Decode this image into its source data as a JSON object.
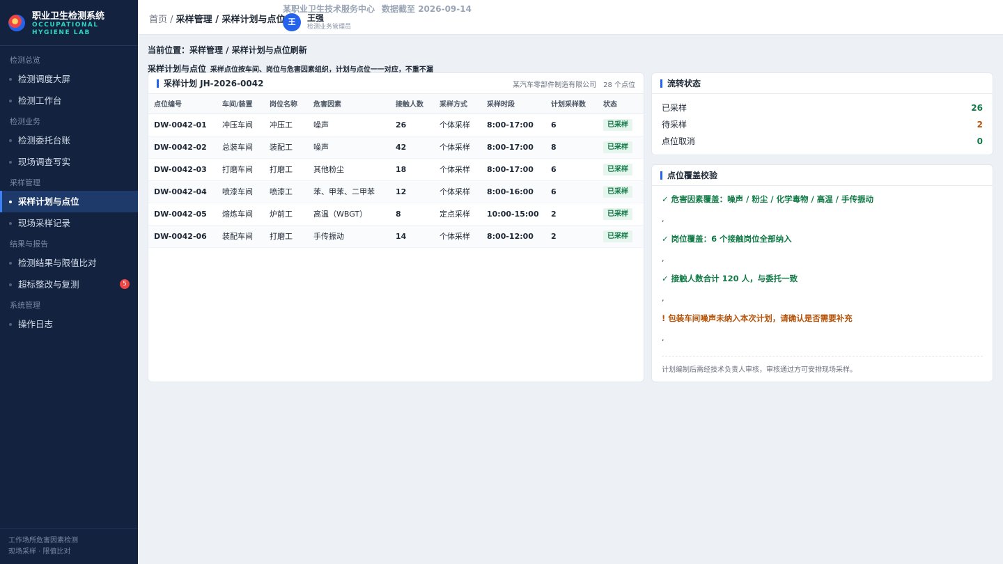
{
  "brand": {
    "title": "职业卫生检测系统",
    "subtitle_line1": "OCCUPATIONAL",
    "subtitle_line2": "HYGIENE LAB"
  },
  "sidebar": {
    "groups": [
      {
        "label": "检测总览",
        "items": [
          {
            "label": "检测调度大屏"
          },
          {
            "label": "检测工作台"
          }
        ]
      },
      {
        "label": "检测业务",
        "items": [
          {
            "label": "检测委托台账"
          },
          {
            "label": "现场调查写实"
          }
        ]
      },
      {
        "label": "采样管理",
        "items": [
          {
            "label": "采样计划与点位",
            "active": true
          },
          {
            "label": "现场采样记录"
          }
        ]
      },
      {
        "label": "结果与报告",
        "items": [
          {
            "label": "检测结果与限值比对"
          },
          {
            "label": "超标整改与复测",
            "badge": "5"
          }
        ]
      },
      {
        "label": "系统管理",
        "items": [
          {
            "label": "操作日志"
          }
        ]
      }
    ],
    "footer_line1": "工作场所危害因素检测",
    "footer_line2": "现场采样 · 限值比对"
  },
  "header": {
    "crumb_home": "首页",
    "crumb_sep": " / ",
    "crumb_path": "采样管理 / 采样计划与点位",
    "org": "某职业卫生技术服务中心",
    "data_date": "数据截至 2026-09-14",
    "user": {
      "avatar": "王",
      "name": "王强",
      "role": "检测业务管理员"
    }
  },
  "page": {
    "location": "当前位置：采样管理 / 采样计划与点位刷新",
    "intro_title": "采样计划与点位",
    "intro_desc": "采样点位按车间、岗位与危害因素组织，计划与点位一一对应，不重不漏"
  },
  "plan": {
    "title": "采样计划 JH-2026-0042",
    "company": "某汽车零部件制造有限公司",
    "point_count": "28 个点位",
    "columns": [
      "点位编号",
      "车间/装置",
      "岗位名称",
      "危害因素",
      "接触人数",
      "采样方式",
      "采样时段",
      "计划采样数",
      "状态"
    ],
    "rows": [
      {
        "code": "DW-0042-01",
        "workshop": "冲压车间",
        "post": "冲压工",
        "hazard": "噪声",
        "people": "26",
        "method": "个体采样",
        "slot": "8:00-17:00",
        "planned": "6",
        "status": "已采样"
      },
      {
        "code": "DW-0042-02",
        "workshop": "总装车间",
        "post": "装配工",
        "hazard": "噪声",
        "people": "42",
        "method": "个体采样",
        "slot": "8:00-17:00",
        "planned": "8",
        "status": "已采样"
      },
      {
        "code": "DW-0042-03",
        "workshop": "打磨车间",
        "post": "打磨工",
        "hazard": "其他粉尘",
        "people": "18",
        "method": "个体采样",
        "slot": "8:00-17:00",
        "planned": "6",
        "status": "已采样"
      },
      {
        "code": "DW-0042-04",
        "workshop": "喷漆车间",
        "post": "喷漆工",
        "hazard": "苯、甲苯、二甲苯",
        "people": "12",
        "method": "个体采样",
        "slot": "8:00-16:00",
        "planned": "6",
        "status": "已采样"
      },
      {
        "code": "DW-0042-05",
        "workshop": "熔炼车间",
        "post": "炉前工",
        "hazard": "高温（WBGT）",
        "people": "8",
        "method": "定点采样",
        "slot": "10:00-15:00",
        "planned": "2",
        "status": "已采样"
      },
      {
        "code": "DW-0042-06",
        "workshop": "装配车间",
        "post": "打磨工",
        "hazard": "手传振动",
        "people": "14",
        "method": "个体采样",
        "slot": "8:00-12:00",
        "planned": "2",
        "status": "已采样"
      }
    ]
  },
  "flow": {
    "title": "流转状态",
    "items": [
      {
        "label": "已采样",
        "value": "26",
        "color": "#0f7a45"
      },
      {
        "label": "待采样",
        "value": "2",
        "color": "#b45309"
      },
      {
        "label": "点位取消",
        "value": "0",
        "color": "#0f7a45"
      }
    ]
  },
  "check": {
    "title": "点位覆盖校验",
    "items": [
      {
        "text": "✓ 危害因素覆盖：噪声 / 粉尘 / 化学毒物 / 高温 / 手传振动",
        "kind": "ok"
      },
      {
        "text": "✓ 岗位覆盖：6 个接触岗位全部纳入",
        "kind": "ok"
      },
      {
        "text": "✓ 接触人数合计 120 人，与委托一致",
        "kind": "ok"
      },
      {
        "text": "! 包装车间噪声未纳入本次计划，请确认是否需要补充",
        "kind": "warn"
      }
    ],
    "separator": ",",
    "note": "计划编制后需经技术负责人审核，审核通过方可安排现场采样。"
  },
  "colors": {
    "accent": "#2563eb",
    "sidebar_bg": "#13233f",
    "ok": "#0f7a45",
    "warn": "#b45309",
    "badge": "#ef4444"
  }
}
